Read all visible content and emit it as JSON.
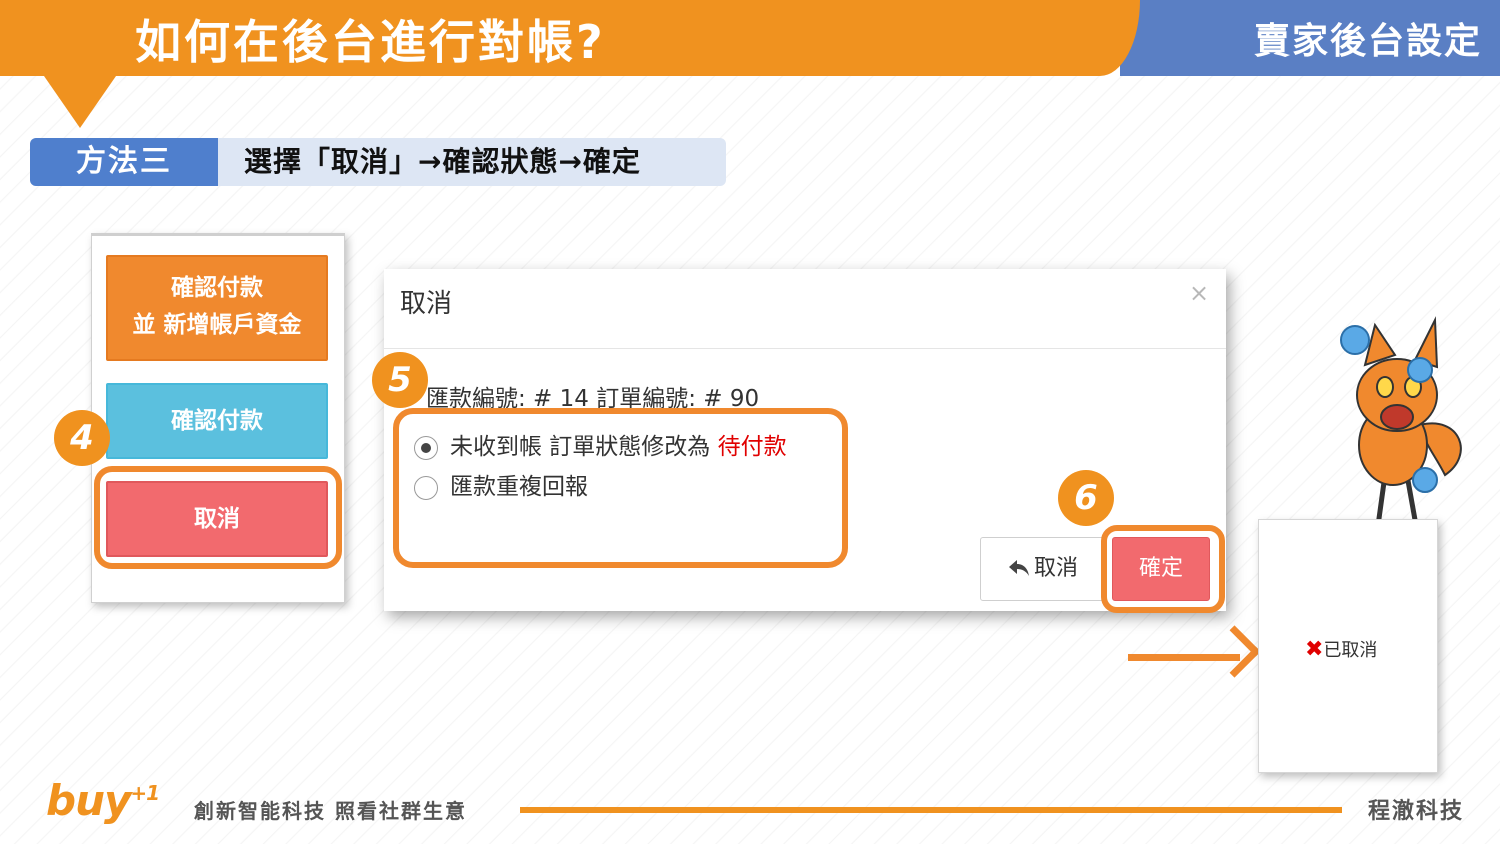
{
  "header": {
    "title": "如何在後台進行對帳?",
    "subtitle": "賣家後台設定"
  },
  "method": {
    "tag": "方法三",
    "description": "選擇「取消」→確認狀態→確定"
  },
  "button_panel": {
    "confirm_add_line1": "確認付款",
    "confirm_add_line2": "並 新增帳戶資金",
    "confirm_payment": "確認付款",
    "cancel": "取消"
  },
  "steps": {
    "step4": "4",
    "step5": "5",
    "step6": "6"
  },
  "modal": {
    "title": "取消",
    "close": "×",
    "info": "匯款編號: # 14   訂單編號: # 90",
    "option1_text": "未收到帳 訂單狀態修改為",
    "option1_status": "待付款",
    "option2_text": "匯款重複回報",
    "back_button": "取消",
    "back_icon": "reply-arrow-icon",
    "ok_button": "確定"
  },
  "result": {
    "icon": "x-mark-icon",
    "status": "已取消"
  },
  "footer": {
    "logo": "buy",
    "logo_sup": "+1",
    "slogan": "創新智能科技 照看社群生意",
    "company": "程澈科技"
  },
  "colors": {
    "orange": "#f0921f",
    "blue": "#5a7fc4",
    "cancel_red": "#f26a6e",
    "info_cyan": "#5bc0de"
  }
}
